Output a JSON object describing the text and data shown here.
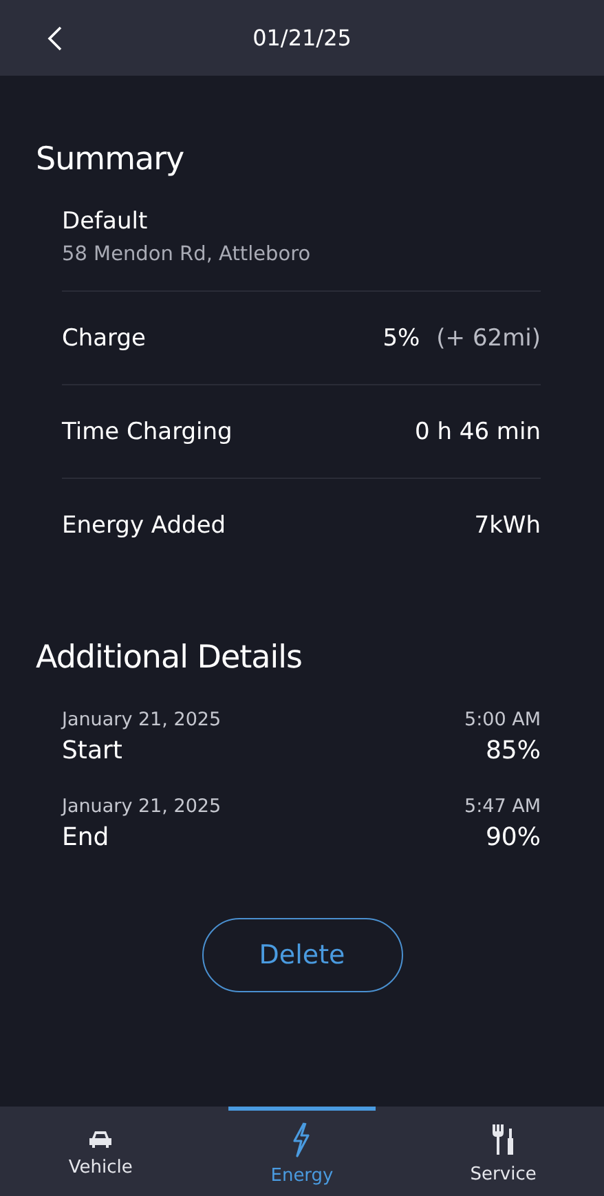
{
  "header": {
    "title": "01/21/25"
  },
  "summary": {
    "title": "Summary",
    "location": {
      "name": "Default",
      "address": "58 Mendon Rd, Attleboro"
    },
    "rows": [
      {
        "label": "Charge",
        "value": "5%",
        "extra": "(+ 62mi)"
      },
      {
        "label": "Time Charging",
        "value": "0 h 46 min"
      },
      {
        "label": "Energy Added",
        "value": "7kWh"
      }
    ]
  },
  "details": {
    "title": "Additional Details",
    "rows": [
      {
        "date": "January 21, 2025",
        "time": "5:00 AM",
        "label": "Start",
        "value": "85%"
      },
      {
        "date": "January 21, 2025",
        "time": "5:47 AM",
        "label": "End",
        "value": "90%"
      }
    ]
  },
  "delete_button": "Delete",
  "tabs": [
    {
      "label": "Vehicle",
      "kind": "car",
      "selected": false
    },
    {
      "label": "Energy",
      "kind": "bolt",
      "selected": true
    },
    {
      "label": "Service",
      "kind": "tools",
      "selected": false
    }
  ]
}
